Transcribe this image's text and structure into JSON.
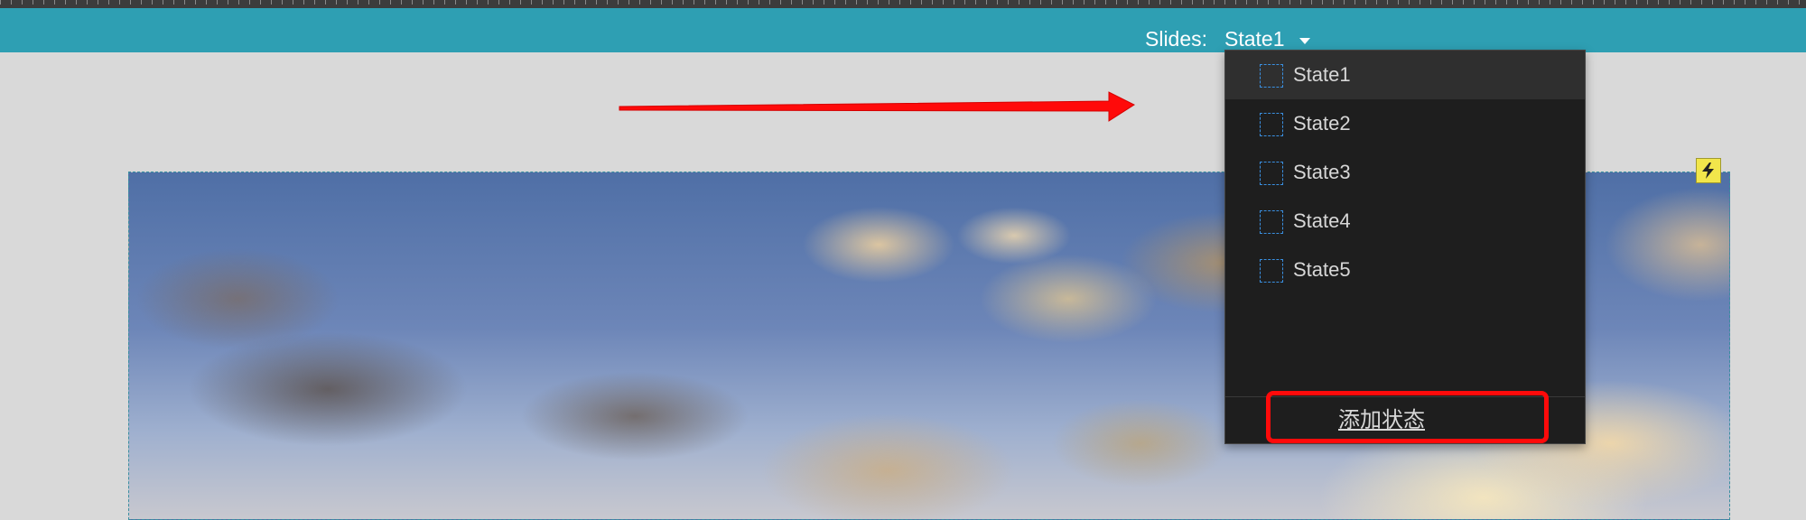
{
  "toolbar": {
    "slides_label": "Slides:",
    "current_state": "State1",
    "accent_color": "#2e9fb3"
  },
  "dropdown": {
    "items": [
      {
        "label": "State1",
        "selected": true
      },
      {
        "label": "State2",
        "selected": false
      },
      {
        "label": "State3",
        "selected": false
      },
      {
        "label": "State4",
        "selected": false
      },
      {
        "label": "State5",
        "selected": false
      }
    ],
    "add_state_label": "添加状态"
  },
  "canvas": {
    "image": "sky-clouds-image",
    "badge_icon": "lightning-icon",
    "annotation_arrow_color": "#ff0a0a",
    "annotation_box_color": "#ff0a0a"
  }
}
